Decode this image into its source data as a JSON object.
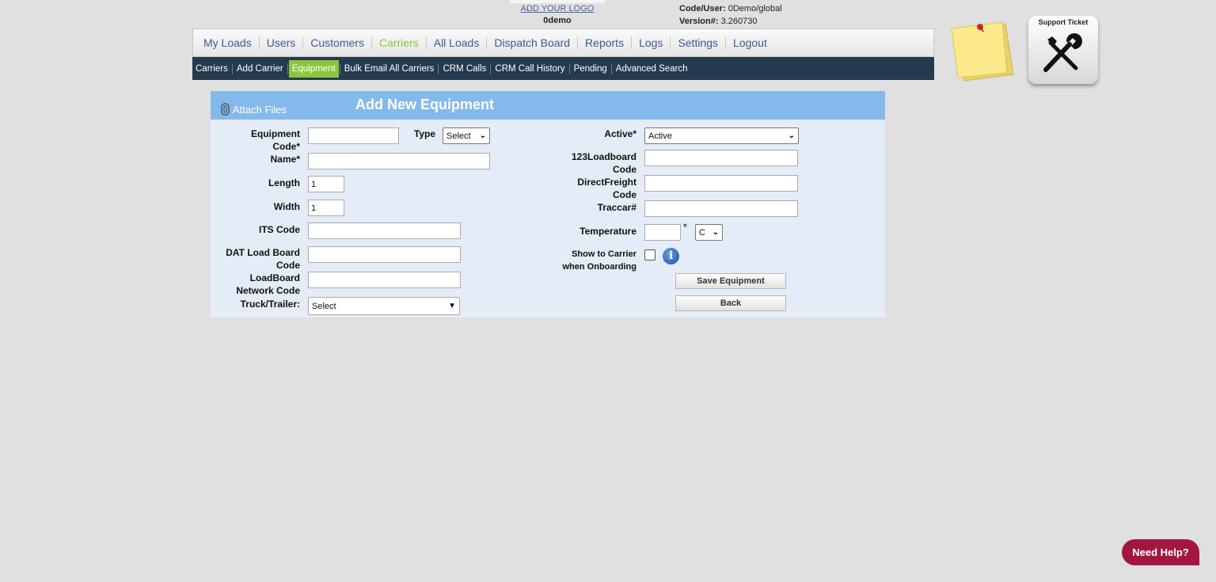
{
  "header": {
    "logo_link": "ADD YOUR LOGO",
    "company": "0demo",
    "code_user_label": "Code/User:",
    "code_user_value": "0Demo/global",
    "version_label": "Version#:",
    "version_value": "3.260730"
  },
  "main_nav": [
    "My Loads",
    "Users",
    "Customers",
    "Carriers",
    "All Loads",
    "Dispatch Board",
    "Reports",
    "Logs",
    "Settings",
    "Logout"
  ],
  "main_nav_active": "Carriers",
  "sub_nav": [
    "Carriers",
    "Add Carrier",
    "Equipment",
    "Bulk Email All Carriers",
    "CRM Calls",
    "CRM Call History",
    "Pending",
    "Advanced Search"
  ],
  "sub_nav_active": "Equipment",
  "support_label": "Support Ticket",
  "panel": {
    "attach_label": "Attach Files",
    "title": "Add New Equipment"
  },
  "form": {
    "equipment_code": {
      "label_1": "Equipment",
      "label_2": "Code*",
      "value": ""
    },
    "type": {
      "label": "Type",
      "selected": "Select"
    },
    "name": {
      "label": "Name*",
      "value": ""
    },
    "length": {
      "label": "Length",
      "value": "1"
    },
    "width": {
      "label": "Width",
      "value": "1"
    },
    "its_code": {
      "label": "ITS Code",
      "value": ""
    },
    "dat_code": {
      "label_1": "DAT Load Board",
      "label_2": "Code",
      "value": ""
    },
    "loadboard_network": {
      "label_1": "LoadBoard",
      "label_2": "Network Code",
      "value": ""
    },
    "truck_trailer": {
      "label": "Truck/Trailer:",
      "selected": "Select"
    },
    "active": {
      "label": "Active*",
      "selected": "Active"
    },
    "loadboard_123": {
      "label_1": "123Loadboard",
      "label_2": "Code",
      "value": ""
    },
    "directfreight": {
      "label_1": "DirectFreight",
      "label_2": "Code",
      "value": ""
    },
    "traccar": {
      "label": "Traccar#",
      "value": ""
    },
    "temperature": {
      "label": "Temperature",
      "value": "",
      "degree": "°",
      "unit": "C"
    },
    "show_carrier": {
      "label_1": "Show to Carrier",
      "label_2": "when Onboarding",
      "checked": false
    },
    "info_glyph": "i",
    "save_button": "Save Equipment",
    "back_button": "Back"
  },
  "need_help": "Need Help?",
  "colors": {
    "accent_green": "#8cc63f",
    "nav_dark": "#263a4e",
    "panel_header": "#84b9ec",
    "need_help": "#a3173f"
  }
}
